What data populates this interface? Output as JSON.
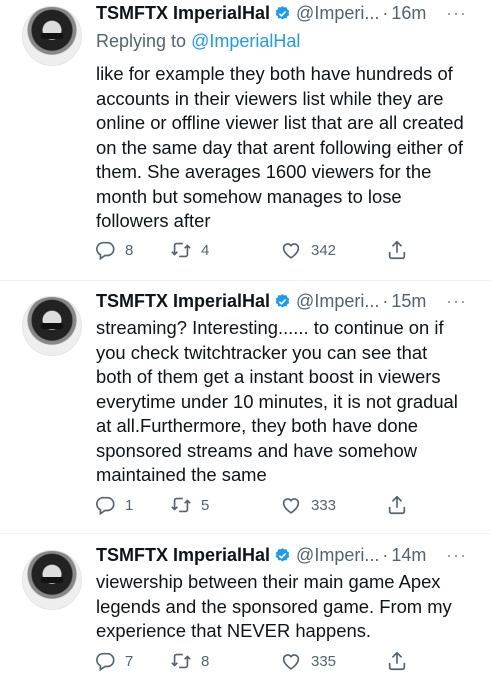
{
  "tweets": [
    {
      "name": "TSMFTX ImperialHal",
      "handle": "@Imperi...",
      "dot": "·",
      "time": "16m",
      "more": "···",
      "reply_prefix": "Replying to ",
      "reply_mention": "@ImperialHal",
      "text": "like for example they both have hundreds of accounts in their viewers list while they are online or offline viewer list that are all created on the same day that arent following either of them. She averages 1600 viewers for the month but somehow manages to lose followers after",
      "replies": "8",
      "retweets": "4",
      "likes": "342"
    },
    {
      "name": "TSMFTX ImperialHal",
      "handle": "@Imperi...",
      "dot": "·",
      "time": "15m",
      "more": "···",
      "text": "streaming? Interesting...... to continue on if you check twitchtracker you can see that both of them get a instant boost in viewers everytime under 10 minutes, it is not gradual at all.Furthermore, they both have done sponsored streams and have somehow maintained the same",
      "replies": "1",
      "retweets": "5",
      "likes": "333"
    },
    {
      "name": "TSMFTX ImperialHal",
      "handle": "@Imperi...",
      "dot": "·",
      "time": "14m",
      "more": "···",
      "text": "viewership between their main game Apex legends and the sponsored game. From my experience that NEVER happens.",
      "replies": "7",
      "retweets": "8",
      "likes": "335"
    }
  ],
  "colors": {
    "accent": "#1d9bf0",
    "secondary_text": "#536471",
    "divider": "#eff3f4"
  },
  "icons": [
    "verified-badge-icon",
    "reply-icon",
    "retweet-icon",
    "like-icon",
    "share-icon",
    "more-icon"
  ]
}
